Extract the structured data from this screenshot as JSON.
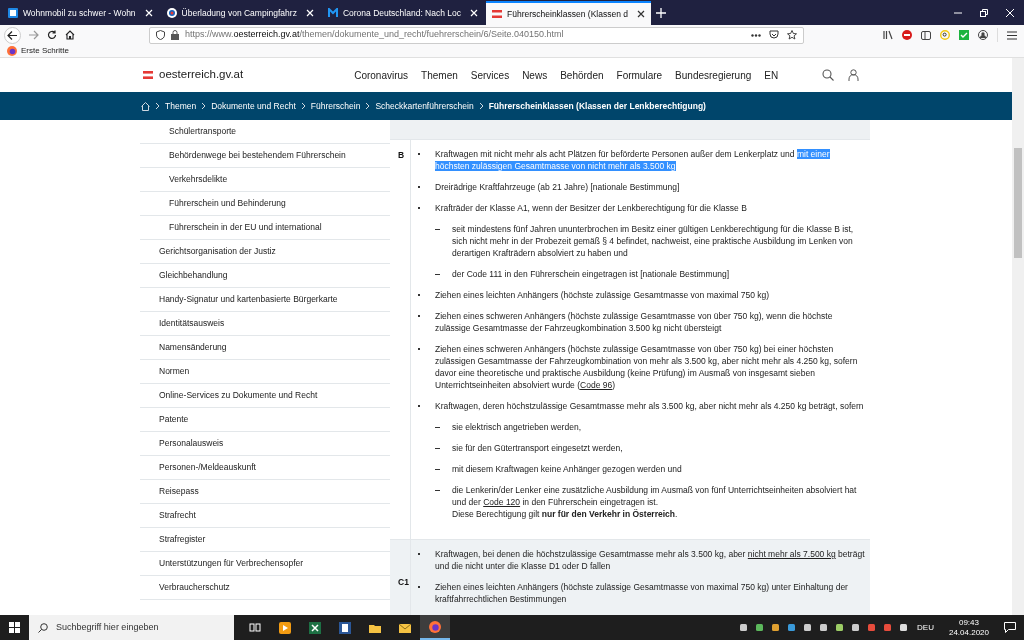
{
  "browser": {
    "tabs": [
      {
        "title": "Wohnmobil zu schwer - Wohn",
        "selected": false
      },
      {
        "title": "Überladung von Campingfahrz",
        "selected": false
      },
      {
        "title": "Corona Deutschland: Nach Loc",
        "selected": false
      },
      {
        "title": "Führerscheinklassen (Klassen d",
        "selected": true
      }
    ],
    "url": {
      "prefix": "https://www.",
      "domain": "oesterreich.gv.at",
      "path": "/themen/dokumente_und_recht/fuehrerschein/6/Seite.040150.html"
    },
    "bookmarks": [
      "Erste Schritte"
    ]
  },
  "site": {
    "logo": "oesterreich.gv.at",
    "nav": [
      "Coronavirus",
      "Themen",
      "Services",
      "News",
      "Behörden",
      "Formulare",
      "Bundesregierung",
      "EN"
    ],
    "breadcrumb": [
      "Themen",
      "Dokumente und Recht",
      "Führerschein",
      "Scheckkartenführerschein",
      "Führerscheinklassen (Klassen der Lenkberechtigung)"
    ]
  },
  "sidebar": {
    "items": [
      {
        "text": "Schülertransporte",
        "kind": "subitem"
      },
      {
        "text": "Behördenwege bei bestehendem Führerschein",
        "kind": "subitem"
      },
      {
        "text": "Verkehrsdelikte",
        "kind": "subitem"
      },
      {
        "text": "Führerschein und Behinderung",
        "kind": "subitem"
      },
      {
        "text": "Führerschein in der EU und international",
        "kind": "subitem"
      },
      {
        "text": "Gerichtsorganisation der Justiz",
        "kind": "item"
      },
      {
        "text": "Gleichbehandlung",
        "kind": "item"
      },
      {
        "text": "Handy-Signatur und kartenbasierte Bürgerkarte",
        "kind": "item"
      },
      {
        "text": "Identitätsausweis",
        "kind": "item"
      },
      {
        "text": "Namensänderung",
        "kind": "item"
      },
      {
        "text": "Normen",
        "kind": "item"
      },
      {
        "text": "Online-Services zu Dokumente und Recht",
        "kind": "item"
      },
      {
        "text": "Patente",
        "kind": "item"
      },
      {
        "text": "Personalausweis",
        "kind": "item"
      },
      {
        "text": "Personen-/Meldeauskunft",
        "kind": "item"
      },
      {
        "text": "Reisepass",
        "kind": "item"
      },
      {
        "text": "Strafrecht",
        "kind": "item"
      },
      {
        "text": "Strafregister",
        "kind": "item"
      },
      {
        "text": "Unterstützungen für Verbrechensopfer",
        "kind": "item"
      },
      {
        "text": "Verbraucherschutz",
        "kind": "item"
      }
    ]
  },
  "classes": [
    {
      "label": "B",
      "shaded": false,
      "items": [
        {
          "kind": "bullet",
          "parts": [
            {
              "kind": "plain",
              "text": "Kraftwagen mit nicht mehr als acht Plätzen für beförderte Personen außer dem Lenkerplatz und "
            },
            {
              "kind": "selected",
              "text": "mit einer höchsten zulässigen Gesamtmasse von nicht mehr als 3.500 kg"
            }
          ]
        },
        {
          "kind": "bullet",
          "parts": [
            {
              "kind": "plain",
              "text": "Dreirädrige Kraftfahrzeuge (ab 21 Jahre) [nationale Bestimmung]"
            }
          ]
        },
        {
          "kind": "bullet",
          "parts": [
            {
              "kind": "plain",
              "text": "Krafträder der Klasse A1, wenn der Besitzer der Lenkberechtigung für die Klasse B"
            }
          ]
        },
        {
          "kind": "dash",
          "parts": [
            {
              "kind": "plain",
              "text": "seit mindestens fünf Jahren ununterbrochen im Besitz einer gültigen Lenkberechtigung für die Klasse B ist, sich nicht mehr in der Probezeit gemäß § 4 befindet, nachweist, eine praktische Ausbildung im Lenken von derartigen Krafträdern absolviert zu haben und"
            }
          ]
        },
        {
          "kind": "dash",
          "parts": [
            {
              "kind": "plain",
              "text": "der Code 111 in den Führerschein eingetragen ist [nationale Bestimmung]"
            }
          ]
        },
        {
          "kind": "bullet",
          "parts": [
            {
              "kind": "plain",
              "text": "Ziehen eines leichten Anhängers (höchste zulässige Gesamtmasse von maximal 750 kg)"
            }
          ]
        },
        {
          "kind": "bullet",
          "parts": [
            {
              "kind": "plain",
              "text": "Ziehen eines schweren Anhängers (höchste zulässige Gesamtmasse von über 750 kg), wenn die höchste zulässige Gesamtmasse der Fahrzeugkombination 3.500 kg nicht übersteigt"
            }
          ]
        },
        {
          "kind": "bullet",
          "parts": [
            {
              "kind": "plain",
              "text": "Ziehen eines schweren Anhängers (höchste zulässige Gesamtmasse von über 750 kg) bei einer höchsten zulässigen Gesamtmasse der Fahrzeugkombination von mehr als 3.500 kg, aber nicht mehr als 4.250 kg, sofern davor eine theoretische und praktische Ausbildung (keine Prüfung) im Ausmaß von insgesamt sieben Unterrichtseinheiten absolviert wurde ("
            },
            {
              "kind": "link",
              "text": "Code 96"
            },
            {
              "kind": "plain",
              "text": ")"
            }
          ]
        },
        {
          "kind": "bullet",
          "parts": [
            {
              "kind": "plain",
              "text": "Kraftwagen, deren höchstzulässige Gesamtmasse mehr als 3.500 kg, aber nicht mehr als 4.250 kg beträgt, sofern"
            }
          ]
        },
        {
          "kind": "dash",
          "parts": [
            {
              "kind": "plain",
              "text": "sie elektrisch angetrieben werden,"
            }
          ]
        },
        {
          "kind": "dash",
          "parts": [
            {
              "kind": "plain",
              "text": "sie für den Gütertransport eingesetzt werden,"
            }
          ]
        },
        {
          "kind": "dash",
          "parts": [
            {
              "kind": "plain",
              "text": "mit diesem Kraftwagen keine Anhänger gezogen werden und"
            }
          ]
        },
        {
          "kind": "dash",
          "parts": [
            {
              "kind": "plain",
              "text": "die Lenkerin/der Lenker eine zusätzliche Ausbildung im Ausmaß von fünf Unterrichtseinheiten absolviert hat und der "
            },
            {
              "kind": "link",
              "text": "Code 120"
            },
            {
              "kind": "plain",
              "text": " in den Führerschein eingetragen ist."
            }
          ]
        },
        {
          "kind": "note",
          "parts": [
            {
              "kind": "plain",
              "text": "Diese Berechtigung gilt **nur für den Verkehr in Österreich**."
            }
          ]
        }
      ]
    },
    {
      "label": "C1",
      "shaded": true,
      "items": [
        {
          "kind": "bullet",
          "parts": [
            {
              "kind": "plain",
              "text": "Kraftwagen, bei denen die höchstzulässige Gesamtmasse mehr als 3.500 kg, aber "
            },
            {
              "kind": "link",
              "text": "nicht mehr als 7.500 kg"
            },
            {
              "kind": "plain",
              "text": " beträgt und die nicht unter die Klasse D1 oder D fallen"
            }
          ]
        },
        {
          "kind": "bullet",
          "parts": [
            {
              "kind": "plain",
              "text": "Ziehen eines leichten Anhängers (höchste zulässige Gesamtmasse von maximal 750 kg) unter Einhaltung der kraftfahrrechtlichen Bestimmungen"
            }
          ]
        }
      ]
    }
  ],
  "taskbar": {
    "search": {
      "placeholder": "Suchbegriff hier eingeben"
    },
    "language": "DEU",
    "time": "09:43",
    "date": "24.04.2020"
  }
}
